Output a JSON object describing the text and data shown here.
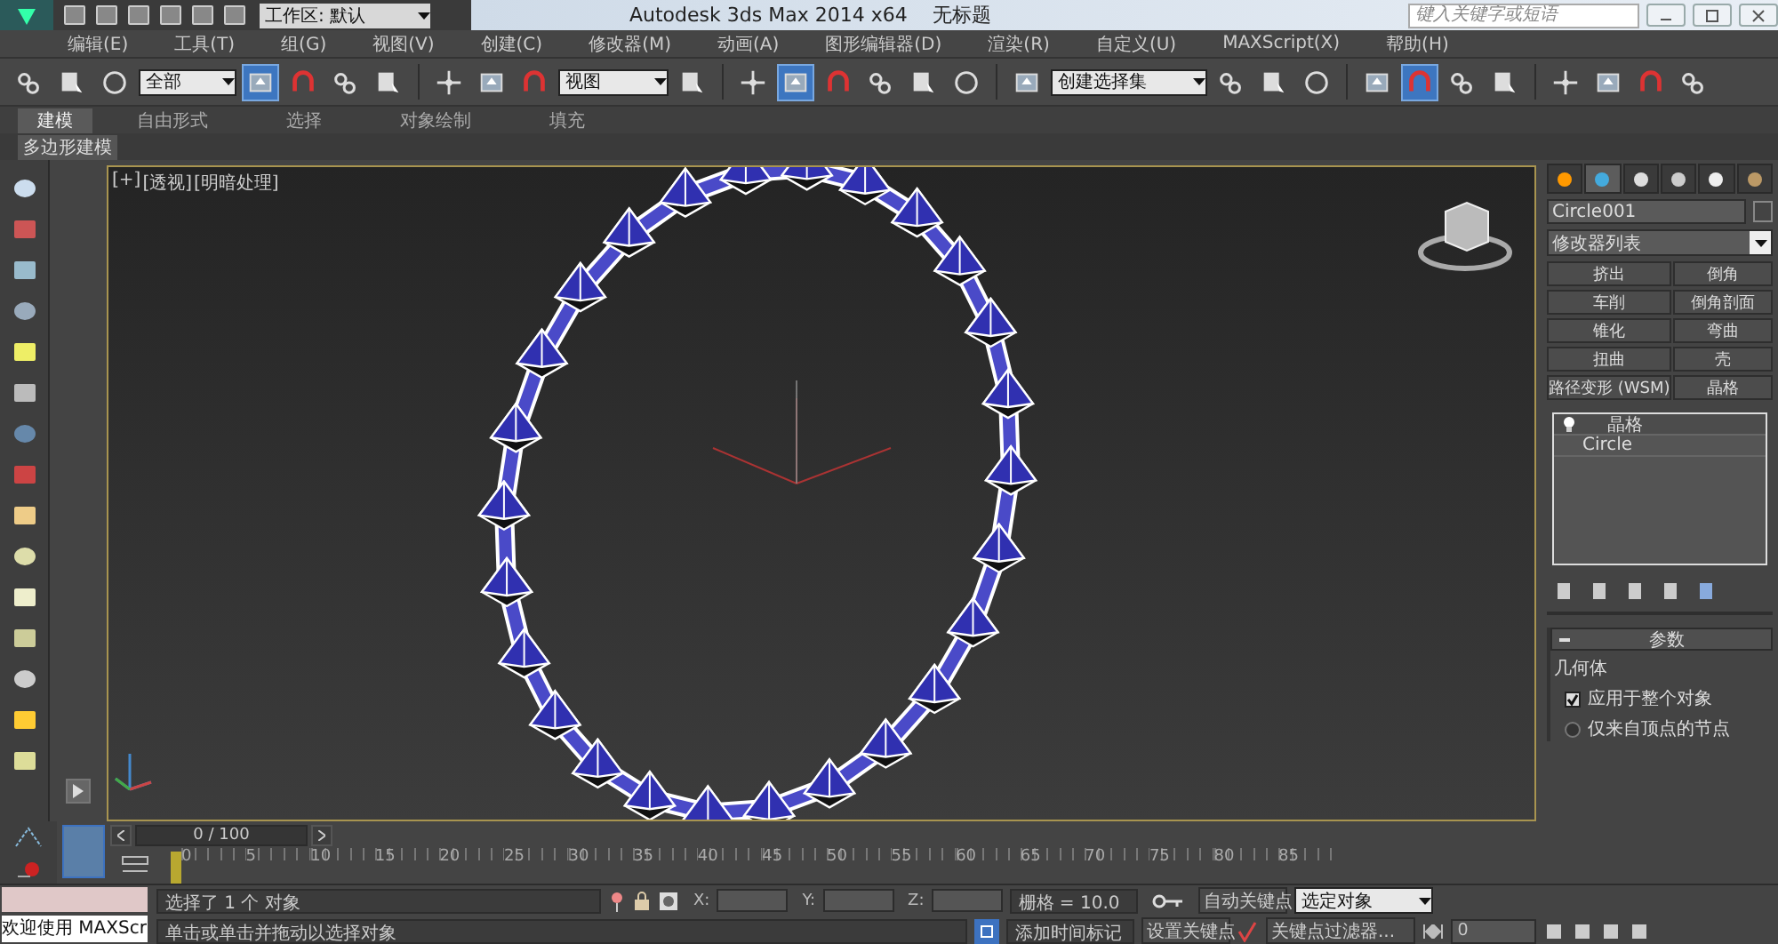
{
  "title_bar": {
    "workspace": "工作区: 默认",
    "title": "Autodesk 3ds Max  2014 x64",
    "document": "无标题",
    "search": {
      "placeholder": "键入关键字或短语"
    }
  },
  "menu": [
    "编辑(E)",
    "工具(T)",
    "组(G)",
    "视图(V)",
    "创建(C)",
    "修改器(M)",
    "动画(A)",
    "图形编辑器(D)",
    "渲染(R)",
    "自定义(U)",
    "MAXScript(X)",
    "帮助(H)"
  ],
  "main_toolbar": [
    {
      "kind": "icon",
      "selected": false
    },
    {
      "kind": "icon",
      "selected": false
    },
    {
      "kind": "icon",
      "selected": false
    },
    {
      "kind": "dropdown",
      "value": "全部"
    },
    {
      "kind": "icon",
      "selected": true
    },
    {
      "kind": "icon",
      "selected": false
    },
    {
      "kind": "icon",
      "selected": false
    },
    {
      "kind": "icon",
      "selected": false
    },
    {
      "kind": "separator"
    },
    {
      "kind": "icon",
      "selected": false
    },
    {
      "kind": "icon",
      "selected": false
    },
    {
      "kind": "icon",
      "selected": false
    },
    {
      "kind": "dropdown",
      "value": "视图"
    },
    {
      "kind": "icon",
      "selected": false
    },
    {
      "kind": "separator"
    },
    {
      "kind": "icon",
      "selected": false
    },
    {
      "kind": "icon",
      "selected": true
    },
    {
      "kind": "icon",
      "selected": false
    },
    {
      "kind": "icon",
      "selected": false
    },
    {
      "kind": "icon",
      "selected": false
    },
    {
      "kind": "icon",
      "selected": false
    },
    {
      "kind": "separator"
    },
    {
      "kind": "icon",
      "selected": false
    },
    {
      "kind": "dropdown",
      "value": "创建选择集"
    },
    {
      "kind": "icon",
      "selected": false
    },
    {
      "kind": "icon",
      "selected": false
    },
    {
      "kind": "icon",
      "selected": false
    },
    {
      "kind": "separator"
    },
    {
      "kind": "icon",
      "selected": false
    },
    {
      "kind": "icon",
      "selected": true
    },
    {
      "kind": "icon",
      "selected": false
    },
    {
      "kind": "icon",
      "selected": false
    },
    {
      "kind": "separator"
    },
    {
      "kind": "icon",
      "selected": false
    },
    {
      "kind": "icon",
      "selected": false
    },
    {
      "kind": "icon",
      "selected": false
    },
    {
      "kind": "icon",
      "selected": false
    }
  ],
  "ribbon": {
    "tabs": [
      {
        "label": "建模",
        "selected": true
      },
      {
        "label": "自由形式",
        "selected": false
      },
      {
        "label": "选择",
        "selected": false
      },
      {
        "label": "对象绘制",
        "selected": false
      },
      {
        "label": "填充",
        "selected": false
      }
    ],
    "panel": "多边形建模"
  },
  "viewport": {
    "labels": [
      "[+]",
      "[透视]",
      "[明暗处理]"
    ]
  },
  "command_panel": {
    "tabs": [
      {
        "selected": false
      },
      {
        "selected": true
      },
      {
        "selected": false
      },
      {
        "selected": false
      },
      {
        "selected": false
      },
      {
        "selected": false
      }
    ],
    "object_name": "Circle001",
    "modifier_list": "修改器列表",
    "modifier_buttons": [
      "挤出",
      "倒角",
      "车削",
      "倒角剖面",
      "锥化",
      "弯曲",
      "扭曲",
      "壳",
      "路径变形 (WSM)",
      "晶格"
    ],
    "stack": [
      {
        "kind": "modifier",
        "label": "晶格"
      },
      {
        "kind": "base",
        "label": "Circle"
      }
    ],
    "rollout": {
      "title": "参数",
      "group": "几何体",
      "options": [
        {
          "kind": "checkbox",
          "label": "应用于整个对象",
          "checked": true
        },
        {
          "kind": "radio",
          "label": "仅来自顶点的节点",
          "selected": false
        }
      ]
    }
  },
  "timeline": {
    "slider": "0 / 100",
    "ticks": [
      "0",
      "5",
      "10",
      "15",
      "20",
      "25",
      "30",
      "35",
      "40",
      "45",
      "50",
      "55",
      "60",
      "65",
      "70",
      "75",
      "80",
      "85"
    ]
  },
  "status": {
    "maxscript": "欢迎使用 MAXScr",
    "selection": "选择了 1 个 对象",
    "prompt": "单击或单击并拖动以选择对象",
    "coords": [
      "X:",
      "Y:",
      "Z:"
    ],
    "grid": "栅格 = 10.0",
    "time_tag": "添加时间标记",
    "auto_key": "自动关键点",
    "set_key": "设置关键点",
    "key_mode": "选定对象",
    "key_filters": "关键点过滤器...",
    "frame": "0"
  }
}
